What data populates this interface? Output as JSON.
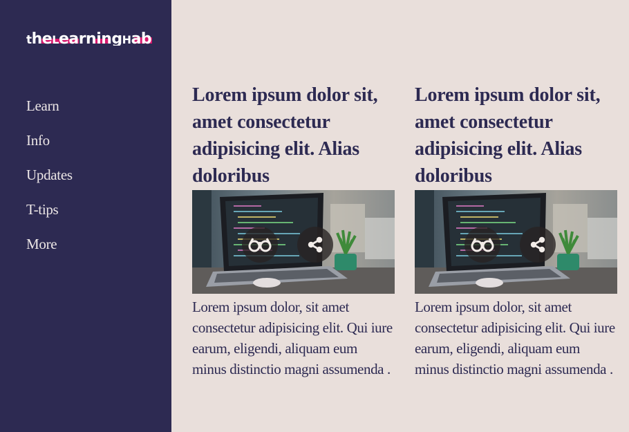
{
  "brand": {
    "logo_text": "theLearningHab",
    "accent_color": "#d8186e",
    "sidebar_color": "#2d2a52"
  },
  "nav": {
    "items": [
      {
        "label": "Learn"
      },
      {
        "label": "Info"
      },
      {
        "label": "Updates"
      },
      {
        "label": "T-tips"
      },
      {
        "label": "More"
      }
    ]
  },
  "cards": [
    {
      "title": "Lorem ipsum dolor sit, amet consectetur adipisicing elit. Alias doloribus",
      "image": "laptop-with-code-photo",
      "actions": {
        "read_icon": "glasses-icon",
        "share_icon": "share-icon"
      },
      "text": "Lorem ipsum dolor, sit amet consectetur adipisicing elit. Qui iure earum, eligendi, aliquam eum minus distinctio magni assumenda ."
    },
    {
      "title": "Lorem ipsum dolor sit, amet consectetur adipisicing elit. Alias doloribus",
      "image": "laptop-with-code-photo",
      "actions": {
        "read_icon": "glasses-icon",
        "share_icon": "share-icon"
      },
      "text": "Lorem ipsum dolor, sit amet consectetur adipisicing elit. Qui iure earum, eligendi, aliquam eum minus distinctio magni assumenda ."
    }
  ]
}
